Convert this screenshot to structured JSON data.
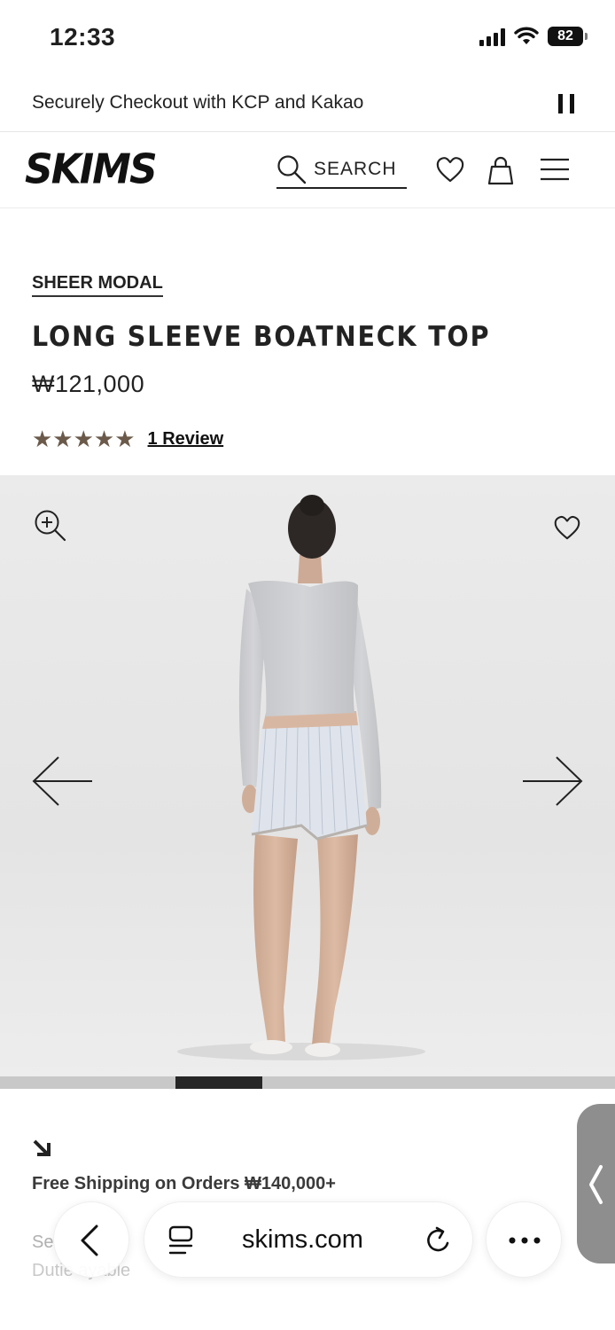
{
  "status_bar": {
    "time": "12:33",
    "battery": "82"
  },
  "announcement": {
    "text": "Securely Checkout with KCP and Kakao"
  },
  "header": {
    "logo": "SKIMS",
    "search_label": "SEARCH"
  },
  "product": {
    "collection": "SHEER MODAL",
    "title": "LONG SLEEVE BOATNECK TOP",
    "price": "₩121,000",
    "stars": "★★★★★",
    "rating_value": 5,
    "review_link": "1 Review"
  },
  "gallery": {
    "progress_fraction": 0.142,
    "progress_position": 0.285
  },
  "shipping": {
    "title": "Free Shipping on Orders ₩140,000+",
    "line2_fragment": "Se",
    "line3_fragment": "Dutie   ayable"
  },
  "browser": {
    "url": "skims.com"
  },
  "icons": {
    "search": "search-icon",
    "wishlist": "heart-icon",
    "bag": "shopping-bag-icon",
    "menu": "hamburger-menu-icon",
    "zoom": "zoom-in-icon",
    "prev": "arrow-left-icon",
    "next": "arrow-right-icon",
    "tabs": "tabs-icon",
    "reload": "reload-icon",
    "more": "more-icon"
  },
  "colors": {
    "star": "#6b5a4a",
    "progress_active": "#262626",
    "progress_track": "#c8c8c8"
  }
}
